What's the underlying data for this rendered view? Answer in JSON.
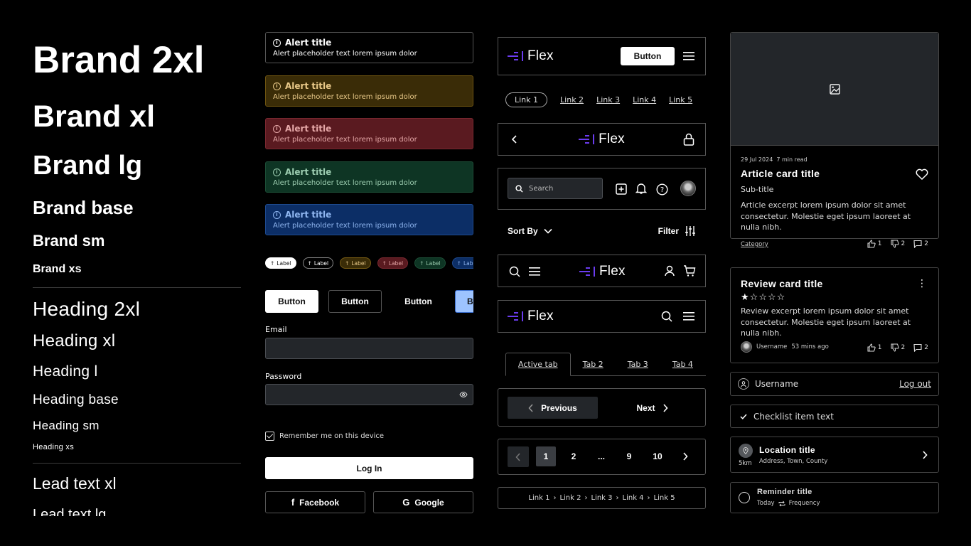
{
  "typography": {
    "brand": [
      "Brand 2xl",
      "Brand xl",
      "Brand lg",
      "Brand base",
      "Brand sm",
      "Brand xs"
    ],
    "heading": [
      "Heading 2xl",
      "Heading xl",
      "Heading l",
      "Heading base",
      "Heading sm",
      "Heading xs"
    ],
    "lead": [
      "Lead text xl",
      "Lead text lg"
    ]
  },
  "alerts": [
    {
      "variant": "neutral",
      "title": "Alert title",
      "text": "Alert placeholder text lorem ipsum dolor"
    },
    {
      "variant": "warning",
      "title": "Alert title",
      "text": "Alert placeholder text lorem ipsum dolor"
    },
    {
      "variant": "error",
      "title": "Alert title",
      "text": "Alert placeholder text lorem ipsum dolor"
    },
    {
      "variant": "success",
      "title": "Alert title",
      "text": "Alert placeholder text lorem ipsum dolor"
    },
    {
      "variant": "info",
      "title": "Alert title",
      "text": "Alert placeholder text lorem ipsum dolor"
    }
  ],
  "tags": [
    {
      "label": "Label",
      "variant": "solid-white"
    },
    {
      "label": "Label",
      "variant": "outline"
    },
    {
      "label": "Label",
      "variant": "warning"
    },
    {
      "label": "Label",
      "variant": "error"
    },
    {
      "label": "Label",
      "variant": "success"
    },
    {
      "label": "Label",
      "variant": "info"
    }
  ],
  "buttons": [
    {
      "label": "Button",
      "variant": "primary"
    },
    {
      "label": "Button",
      "variant": "outline"
    },
    {
      "label": "Button",
      "variant": "ghost"
    },
    {
      "label": "Button",
      "variant": "blue"
    }
  ],
  "form": {
    "email_label": "Email",
    "email_value": "",
    "password_label": "Password",
    "password_value": "",
    "remember_label": "Remember me on this device",
    "remember_checked": true,
    "login_label": "Log In",
    "facebook_label": "Facebook",
    "google_label": "Google"
  },
  "nav": {
    "logo_text": "Flex",
    "header_button": "Button",
    "pill_links": [
      "Link 1",
      "Link 2",
      "Link 3",
      "Link 4",
      "Link 5"
    ],
    "search_placeholder": "Search",
    "sort_label": "Sort By",
    "filter_label": "Filter",
    "tabs": [
      "Active tab",
      "Tab 2",
      "Tab 3",
      "Tab 4"
    ],
    "prev_label": "Previous",
    "next_label": "Next",
    "pages": [
      "1",
      "2",
      "...",
      "9",
      "10"
    ],
    "current_page": "1",
    "breadcrumbs": [
      "Link 1",
      "Link 2",
      "Link 3",
      "Link 4",
      "Link 5"
    ]
  },
  "article": {
    "date": "29 Jul 2024",
    "read_time": "7 min read",
    "title": "Article card title",
    "subtitle": "Sub-title",
    "excerpt": "Article excerpt lorem ipsum dolor sit amet consectetur. Molestie eget ipsum laoreet at nulla nibh.",
    "category": "Category",
    "likes": "1",
    "dislikes": "2",
    "comments": "2"
  },
  "review": {
    "title": "Review card title",
    "rating": 1,
    "rating_max": 5,
    "excerpt": "Review excerpt lorem ipsum dolor sit amet consectetur. Molestie eget ipsum laoreet at nulla nibh.",
    "username": "Username",
    "time_ago": "53 mins ago",
    "likes": "1",
    "dislikes": "2",
    "comments": "2"
  },
  "account": {
    "username": "Username",
    "logout_label": "Log out"
  },
  "checklist": {
    "text": "Checklist item text"
  },
  "location": {
    "title": "Location title",
    "address": "Address, Town, County",
    "distance": "5km"
  },
  "reminder": {
    "title": "Reminder title",
    "when": "Today",
    "frequency": "Frequency"
  },
  "colors": {
    "logo_accent": "#6b3cf0",
    "warning_bg": "#3a2c07",
    "error_bg": "#5a1a20",
    "success_bg": "#0e3524",
    "info_bg": "#0c2e66",
    "input_bg": "#23262a"
  }
}
